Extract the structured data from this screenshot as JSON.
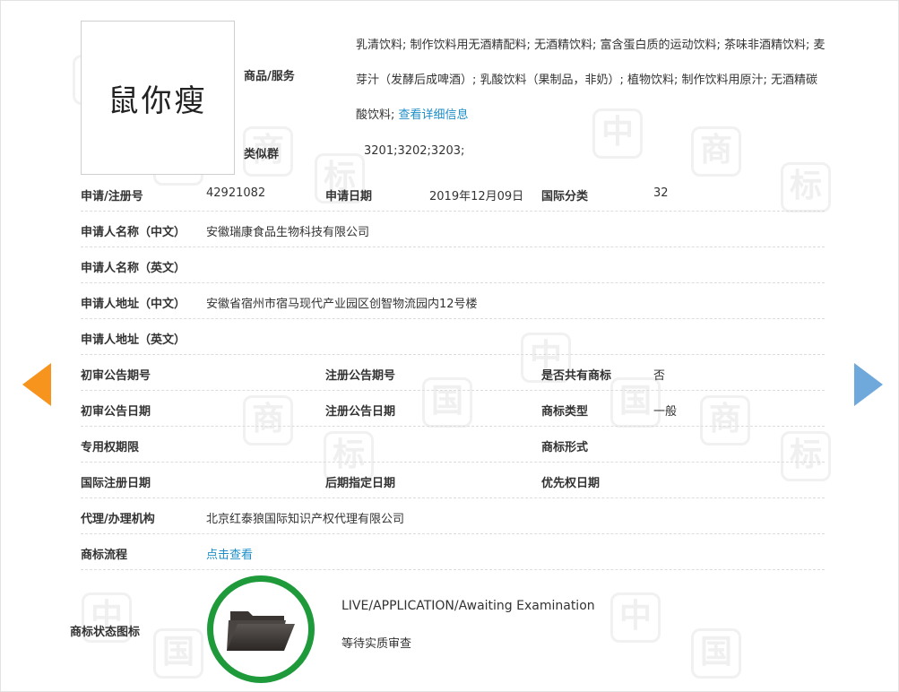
{
  "logo": {
    "text": "鼠你瘦"
  },
  "goods_label": "商品/服务",
  "goods_text": "乳清饮料; 制作饮料用无酒精配料; 无酒精饮料; 富含蛋白质的运动饮料; 茶味非酒精饮料; 麦芽汁（发酵后成啤酒）; 乳酸饮料（果制品，非奶）; 植物饮料; 制作饮料用原汁; 无酒精碳酸饮料; ",
  "goods_link": "查看详细信息",
  "similar_label": "类似群",
  "similar_value": "3201;3202;3203;",
  "fields": {
    "reg_no_label": "申请/注册号",
    "reg_no": "42921082",
    "apply_date_label": "申请日期",
    "apply_date": "2019年12月09日",
    "intl_class_label": "国际分类",
    "intl_class": "32",
    "applicant_cn_label": "申请人名称（中文）",
    "applicant_cn": "安徽瑞康食品生物科技有限公司",
    "applicant_en_label": "申请人名称（英文）",
    "applicant_en": "",
    "address_cn_label": "申请人地址（中文）",
    "address_cn": "安徽省宿州市宿马现代产业园区创智物流园内12号楼",
    "address_en_label": "申请人地址（英文）",
    "address_en": "",
    "prelim_pub_no_label": "初审公告期号",
    "prelim_pub_no": "",
    "reg_pub_no_label": "注册公告期号",
    "reg_pub_no": "",
    "shared_label": "是否共有商标",
    "shared": "否",
    "prelim_pub_date_label": "初审公告日期",
    "prelim_pub_date": "",
    "reg_pub_date_label": "注册公告日期",
    "reg_pub_date": "",
    "mark_type_label": "商标类型",
    "mark_type": "一般",
    "exclusive_label": "专用权期限",
    "exclusive": "",
    "mark_form_label": "商标形式",
    "mark_form": "",
    "intl_reg_date_label": "国际注册日期",
    "intl_reg_date": "",
    "later_date_label": "后期指定日期",
    "later_date": "",
    "priority_label": "优先权日期",
    "priority": "",
    "agent_label": "代理/办理机构",
    "agent": "北京红泰狼国际知识产权代理有限公司",
    "process_label": "商标流程",
    "process_link": "点击查看",
    "status_label": "商标状态图标"
  },
  "status": {
    "en": "LIVE/APPLICATION/Awaiting Examination",
    "cn": "等待实质审查",
    "ring_color": "#1e9a3b"
  },
  "nav": {
    "prev_color": "#f7941d",
    "next_color": "#6fa9dc"
  }
}
